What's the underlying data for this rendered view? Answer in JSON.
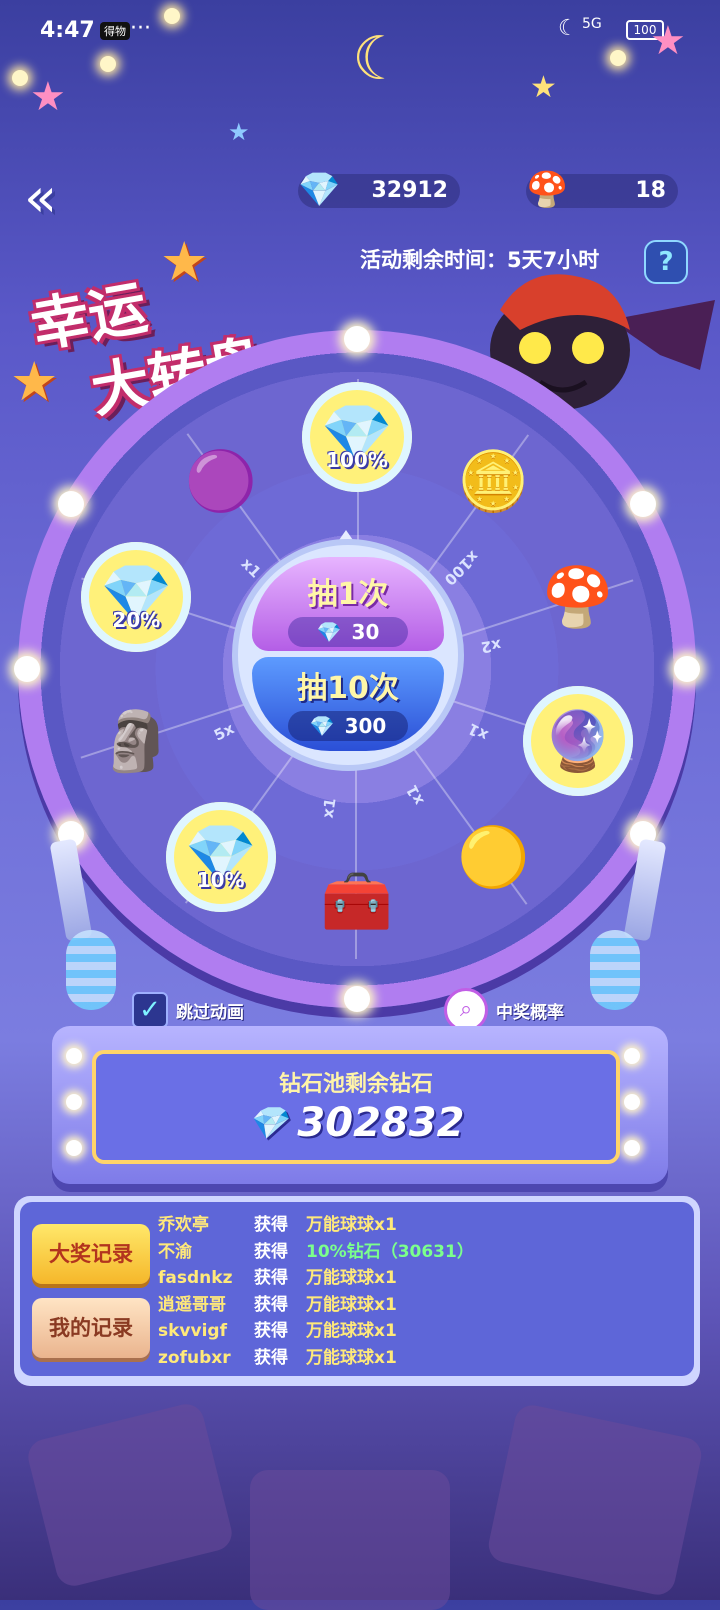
{
  "status_bar": {
    "time": "4:47",
    "carrier_badge": "得物",
    "dots": "···",
    "network": "5G",
    "battery": "100"
  },
  "resources": {
    "gems": "32912",
    "mushrooms": "18"
  },
  "title": {
    "line1": "幸运",
    "line2": "大转盘"
  },
  "timer": "活动剩余时间：5天7小时",
  "help_label": "?",
  "wheel": {
    "prizes": [
      {
        "name": "diamond-100",
        "emoji": "💎",
        "label": "100%"
      },
      {
        "name": "gold-coins",
        "emoji": "🪙",
        "label": ""
      },
      {
        "name": "gold-mushroom",
        "emoji": "🍄",
        "label": ""
      },
      {
        "name": "rainbow-ball",
        "emoji": "🔮",
        "label": ""
      },
      {
        "name": "gold-mystery-ball",
        "emoji": "🟡",
        "label": ""
      },
      {
        "name": "treasure-chest",
        "emoji": "🧰",
        "label": ""
      },
      {
        "name": "diamond-10",
        "emoji": "💎",
        "label": "10%"
      },
      {
        "name": "stone-statue",
        "emoji": "🗿",
        "label": ""
      },
      {
        "name": "diamond-20",
        "emoji": "💎",
        "label": "20%"
      },
      {
        "name": "mystery-ball",
        "emoji": "🟣",
        "label": ""
      }
    ],
    "multipliers": [
      "x100",
      "x2",
      "x1",
      "x1",
      "x1",
      "5x",
      "x1"
    ]
  },
  "draw_one": {
    "label": "抽1次",
    "cost": "30"
  },
  "draw_ten": {
    "label": "抽10次",
    "cost": "300"
  },
  "skip_animation": {
    "label": "跳过动画",
    "checked": true
  },
  "probability": {
    "label": "中奖概率"
  },
  "pool": {
    "label": "钻石池剩余钻石",
    "value": "302832"
  },
  "tabs": {
    "big_prize": "大奖记录",
    "mine": "我的记录"
  },
  "records": [
    {
      "name": "乔欢亭",
      "action": "获得",
      "prize": "万能球球x1",
      "highlight": false
    },
    {
      "name": "不渝",
      "action": "获得",
      "prize": "10%钻石（30631）",
      "highlight": true
    },
    {
      "name": "fasdnkz",
      "action": "获得",
      "prize": "万能球球x1",
      "highlight": false
    },
    {
      "name": "逍遥哥哥",
      "action": "获得",
      "prize": "万能球球x1",
      "highlight": false
    },
    {
      "name": "skvvigf",
      "action": "获得",
      "prize": "万能球球x1",
      "highlight": false
    },
    {
      "name": "zofubxr",
      "action": "获得",
      "prize": "万能球球x1",
      "highlight": false
    }
  ],
  "colors": {
    "accent_yellow": "#ffe97a",
    "highlight_green": "#7bff8c",
    "wheel_pink": "#ff8ad0"
  }
}
